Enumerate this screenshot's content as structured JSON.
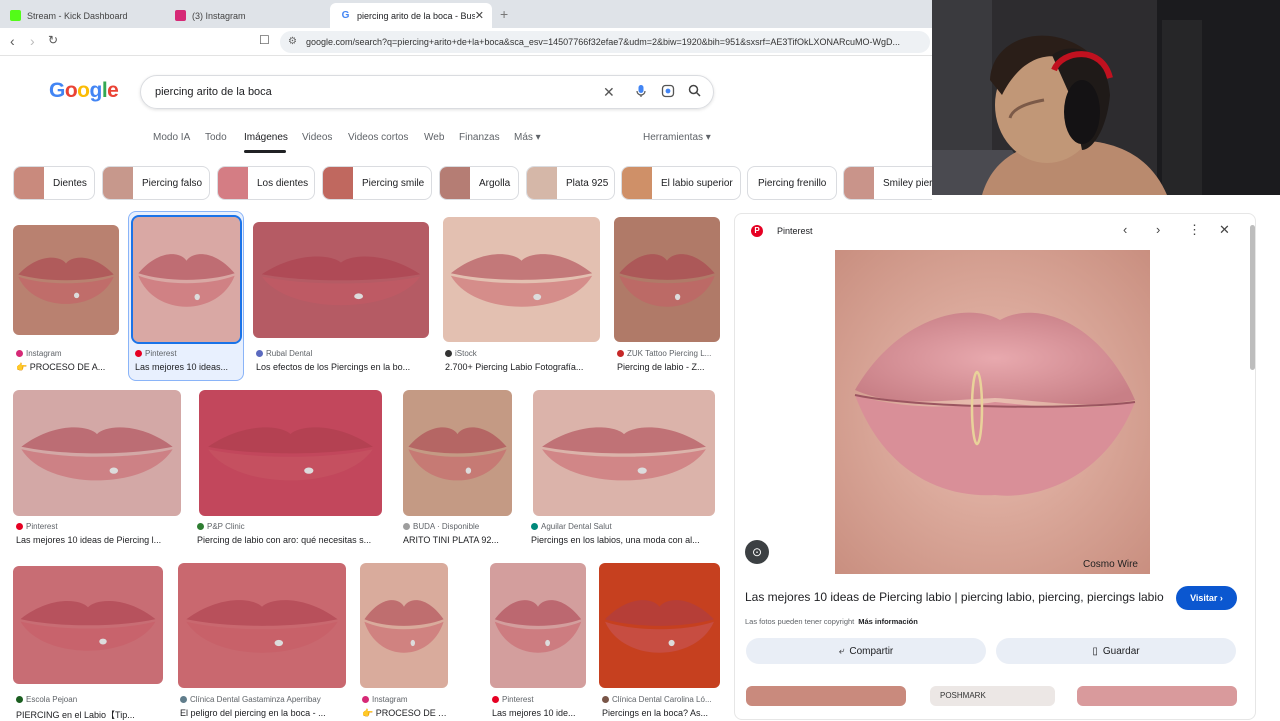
{
  "browser": {
    "tabs": [
      {
        "title": "Stream - Kick Dashboard",
        "favicon_color": "#53fc18"
      },
      {
        "title": "(3) Instagram",
        "favicon_color": "#d62976"
      },
      {
        "title": "piercing arito de la boca - Busca",
        "favicon_color": "#4285f4"
      }
    ],
    "url": "google.com/search?q=piercing+arito+de+la+boca&sca_esv=14507766f32efae7&udm=2&biw=1920&bih=951&sxsrf=AE3TifOkLXONARcuMO-WgD..."
  },
  "search": {
    "logo": "Google",
    "query": "piercing arito de la boca",
    "tabs": [
      "Modo IA",
      "Todo",
      "Imágenes",
      "Videos",
      "Videos cortos",
      "Web",
      "Finanzas",
      "Más"
    ],
    "tools": "Herramientas"
  },
  "chips": [
    {
      "label": "Dientes",
      "color": "#c98a7d"
    },
    {
      "label": "Piercing falso",
      "color": "#c7988c"
    },
    {
      "label": "Los dientes",
      "color": "#d47d84"
    },
    {
      "label": "Piercing smile",
      "color": "#c0685f"
    },
    {
      "label": "Argolla",
      "color": "#b57d74"
    },
    {
      "label": "Plata 925",
      "color": "#d5b7a8"
    },
    {
      "label": "El labio superior",
      "color": "#cf9068"
    },
    {
      "label": "Piercing frenillo",
      "color": ""
    },
    {
      "label": "Smiley pierc",
      "color": "#c9948a"
    }
  ],
  "results": [
    {
      "source": "Instagram",
      "caption": "👉 PROCESO DE A...",
      "src_color": "#d62976",
      "img_color": "#b98170"
    },
    {
      "source": "Pinterest",
      "caption": "Las mejores 10 ideas...",
      "src_color": "#e60023",
      "img_color": "#d9a8a4"
    },
    {
      "source": "Rubal Dental",
      "caption": "Los efectos de los Piercings en la bo...",
      "src_color": "#5b6abf",
      "img_color": "#b55b64"
    },
    {
      "source": "iStock",
      "caption": "2.700+ Piercing Labio Fotografía...",
      "src_color": "#333333",
      "img_color": "#e3c0b1"
    },
    {
      "source": "ZUK Tattoo Piercing L...",
      "caption": "Piercing de labio - Z...",
      "src_color": "#c62828",
      "img_color": "#b07a68"
    },
    {
      "source": "Pinterest",
      "caption": "Las mejores 10 ideas de Piercing l...",
      "src_color": "#e60023",
      "img_color": "#d3a8a6"
    },
    {
      "source": "P&P Clinic",
      "caption": "Piercing de labio con aro: qué necesitas s...",
      "src_color": "#2e7d32",
      "img_color": "#c2475c"
    },
    {
      "source": "BUDA · Disponible",
      "caption": "ARITO TINI PLATA 92...",
      "src_color": "#9e9e9e",
      "img_color": "#c49a84",
      "badge": "Disponible"
    },
    {
      "source": "Aguilar Dental Salut",
      "caption": "Piercings en los labios, una moda con al...",
      "src_color": "#00897b",
      "img_color": "#dbb3aa"
    },
    {
      "source": "Escola Pejoan",
      "caption": "PIERCING en el Labio【Tip...",
      "src_color": "#1b5e20",
      "img_color": "#c86d74"
    },
    {
      "source": "Clínica Dental Gastaminza Aperribay",
      "caption": "El peligro del piercing en la boca - ...",
      "src_color": "#607d8b",
      "img_color": "#c9686f"
    },
    {
      "source": "Instagram",
      "caption": "👉 PROCESO DE AR...",
      "src_color": "#d62976",
      "img_color": "#d9ab9c"
    },
    {
      "source": "Pinterest",
      "caption": "Las mejores 10 ide...",
      "src_color": "#e60023",
      "img_color": "#d39e9d"
    },
    {
      "source": "Clínica Dental Carolina Ló...",
      "caption": "Piercings en la boca? As...",
      "src_color": "#795548",
      "img_color": "#c6401f"
    }
  ],
  "preview": {
    "source": "Pinterest",
    "title": "Las mejores 10 ideas de Piercing labio | piercing labio, piercing, piercings labio",
    "visit": "Visitar",
    "copyright": "Las fotos pueden tener copyright",
    "more_info": "Más información",
    "share": "Compartir",
    "save": "Guardar",
    "watermark": "Cosmo Wire",
    "related_label": "POSHMARK"
  }
}
